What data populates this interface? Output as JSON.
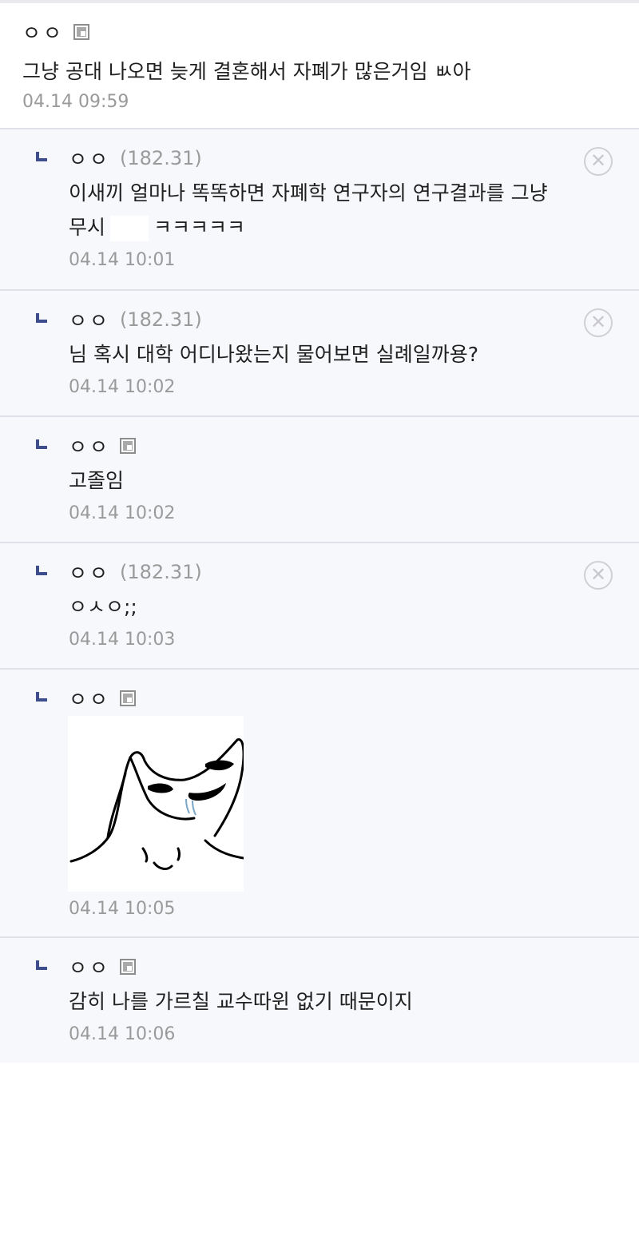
{
  "comments": [
    {
      "nick": "ㅇㅇ",
      "text": "그냥 공대 나오면 늦게 결혼해서 자폐가 많은거임 ㅄ아",
      "date": "04.14 09:59"
    },
    {
      "nick": "ㅇㅇ",
      "ip": "(182.31)",
      "text_a": "이새끼 얼마나 똑똑하면 자폐학 연구자의 연구결과를 그냥",
      "text_b": "무시",
      "text_c": "ㅋㅋㅋㅋㅋ",
      "date": "04.14 10:01"
    },
    {
      "nick": "ㅇㅇ",
      "ip": "(182.31)",
      "text": "님 혹시 대학 어디나왔는지 물어보면 실례일까용?",
      "date": "04.14 10:02"
    },
    {
      "nick": "ㅇㅇ",
      "text": "고졸임",
      "date": "04.14 10:02"
    },
    {
      "nick": "ㅇㅇ",
      "ip": "(182.31)",
      "text": "ㅇㅅㅇ;;",
      "date": "04.14 10:03"
    },
    {
      "nick": "ㅇㅇ",
      "image": "wojak-meme-image",
      "date": "04.14 10:05"
    },
    {
      "nick": "ㅇㅇ",
      "text": "감히 나를 가르칠 교수따윈 없기 때문이지",
      "date": "04.14 10:06"
    }
  ],
  "icons": {
    "delete": "close-circle-icon",
    "badge": "fixed-nick-badge-icon",
    "reply": "reply-arrow-icon"
  },
  "colors": {
    "reply_arrow": "#3e4e8c",
    "reply_bg": "#f7f8fb",
    "meta": "#9a9a9a"
  }
}
